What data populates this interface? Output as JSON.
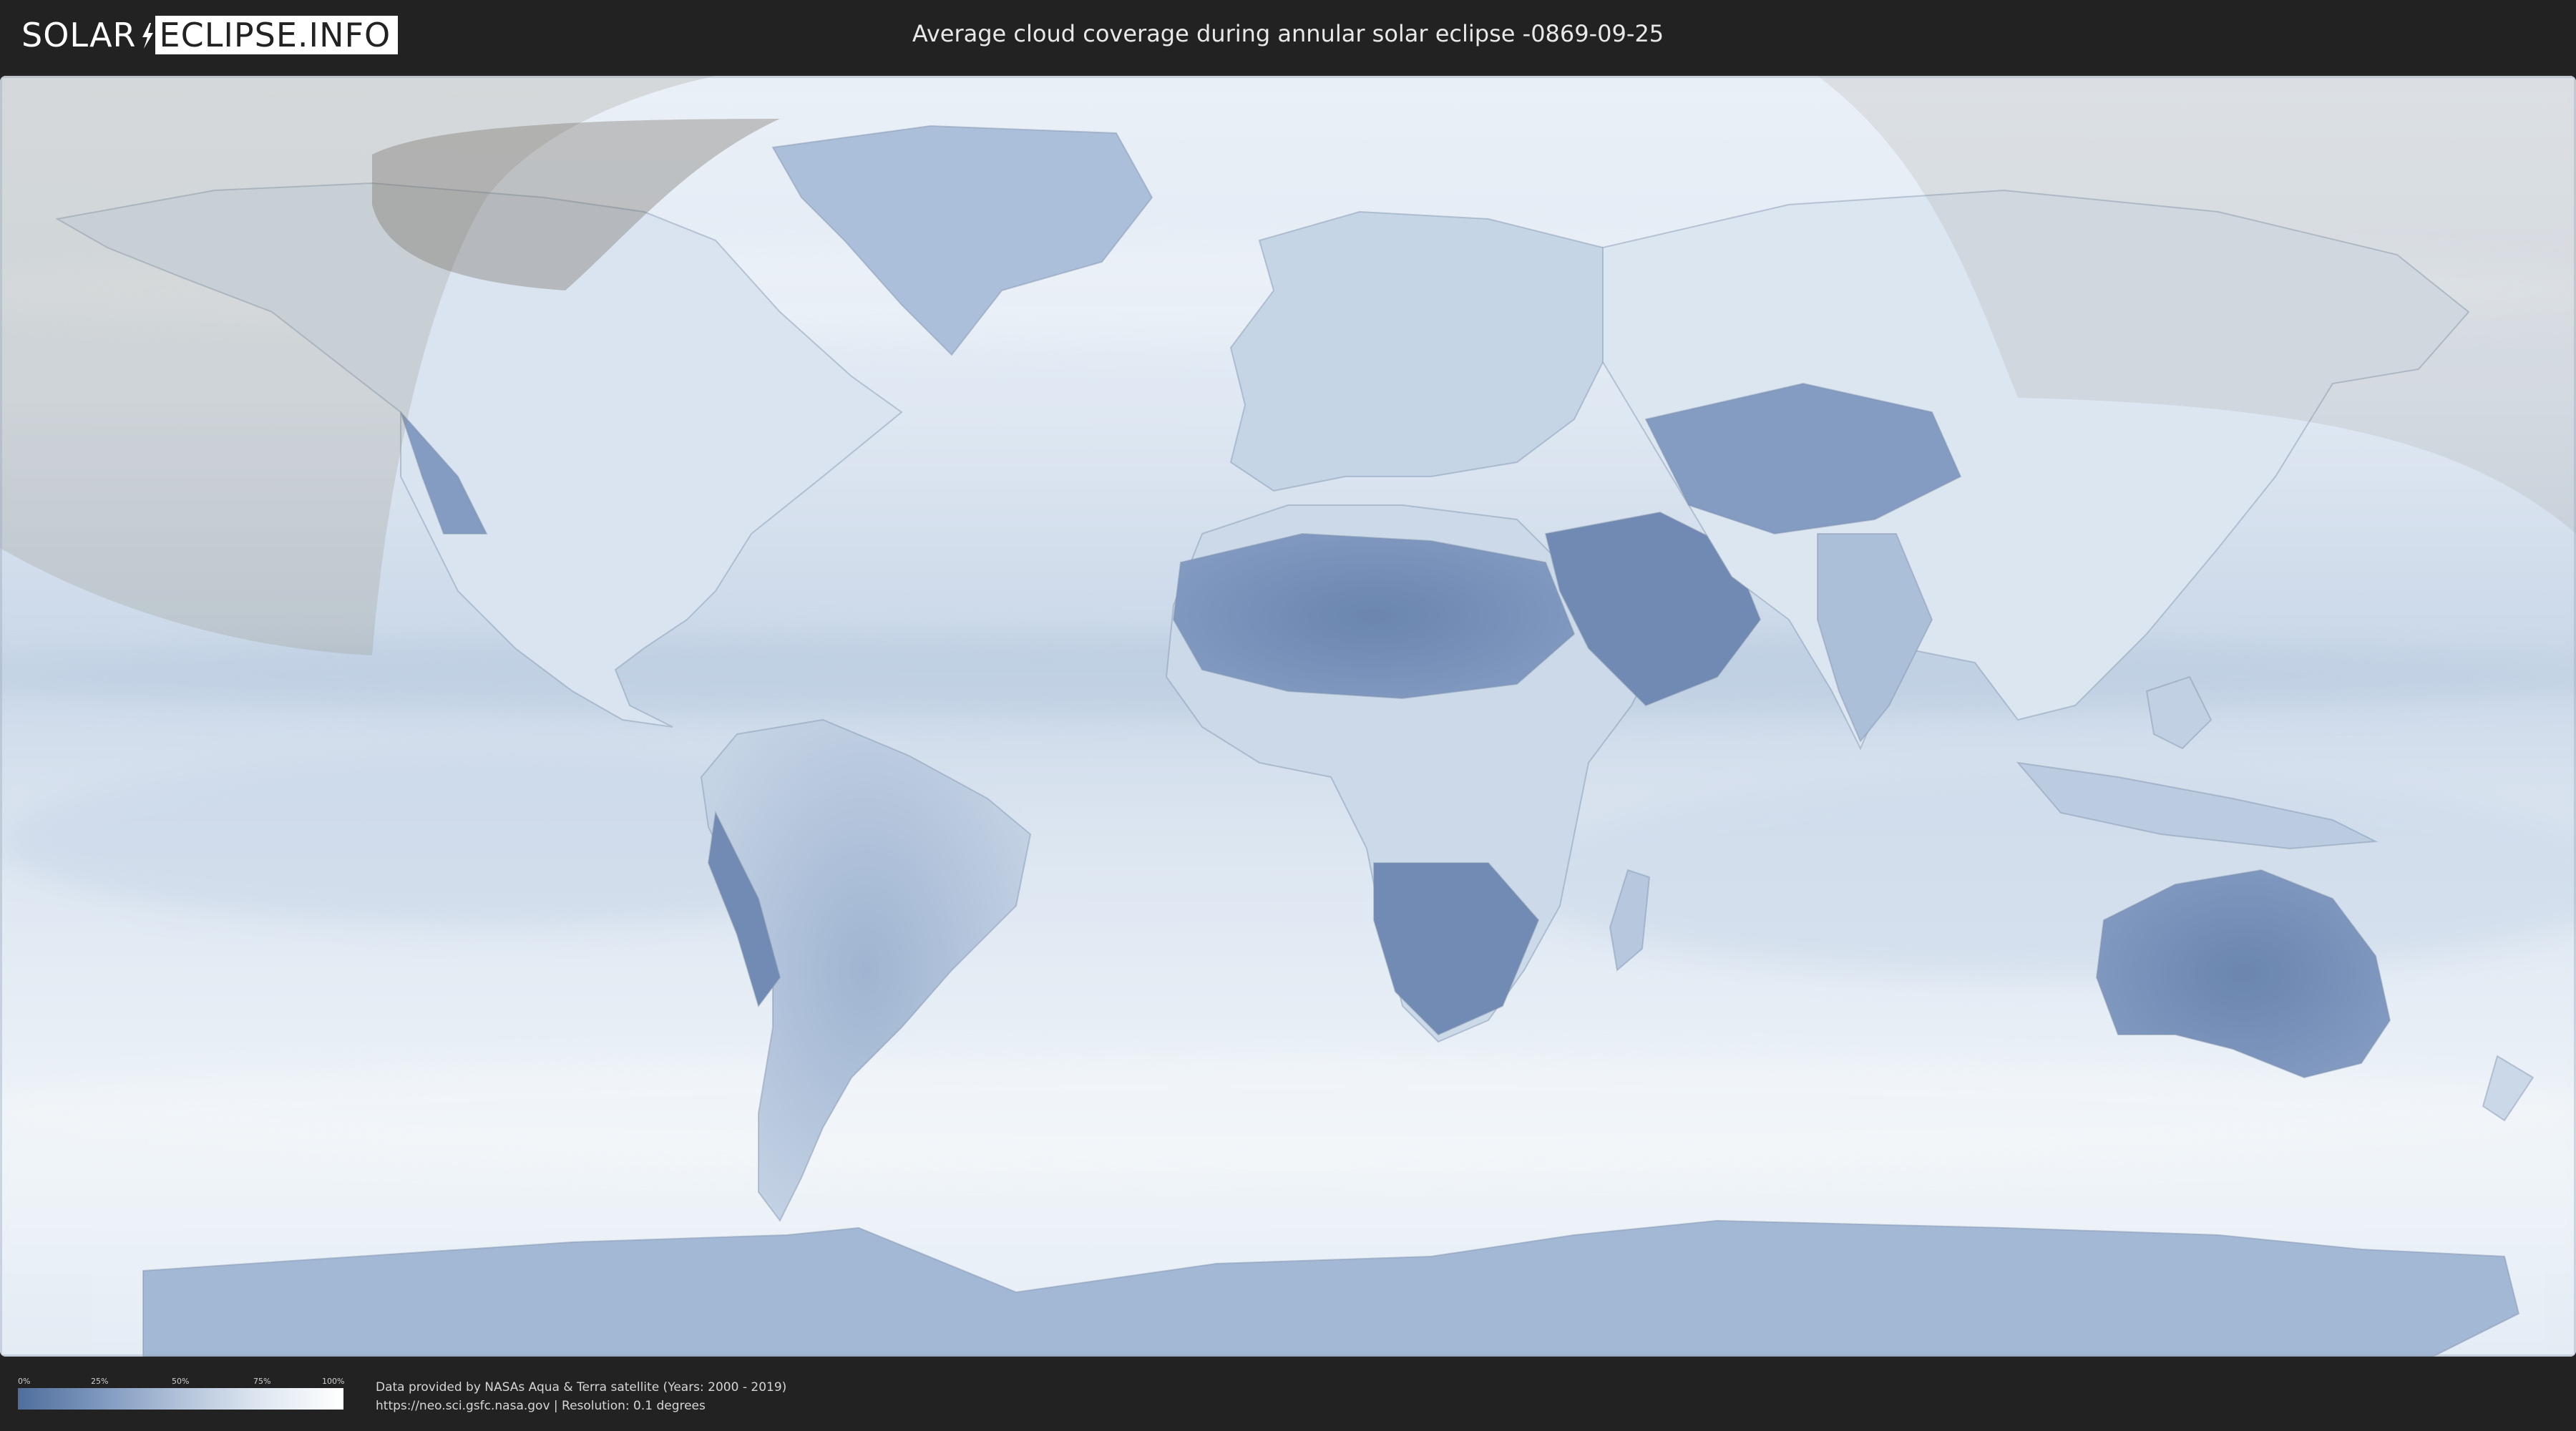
{
  "header": {
    "logo_left": "SOLAR",
    "logo_right": "ECLIPSE.INFO",
    "title": "Average cloud coverage during annular solar eclipse -0869-09-25"
  },
  "map": {
    "projection": "equirectangular world map",
    "layer": "average cloud coverage",
    "features": [
      "country borders",
      "eclipse visibility region (shaded)"
    ],
    "colors": {
      "clear_sky": "#4f6e9c",
      "full_cloud": "#ffffff",
      "shade": "#9d9486"
    }
  },
  "legend": {
    "ticks": [
      "0%",
      "25%",
      "50%",
      "75%",
      "100%"
    ],
    "gradient_start": "#4f6e9c",
    "gradient_end": "#ffffff"
  },
  "footer": {
    "credit_line": "Data provided by NASAs Aqua & Terra satellite (Years: 2000 - 2019)",
    "source_line": "https://neo.sci.gsfc.nasa.gov | Resolution: 0.1 degrees"
  }
}
